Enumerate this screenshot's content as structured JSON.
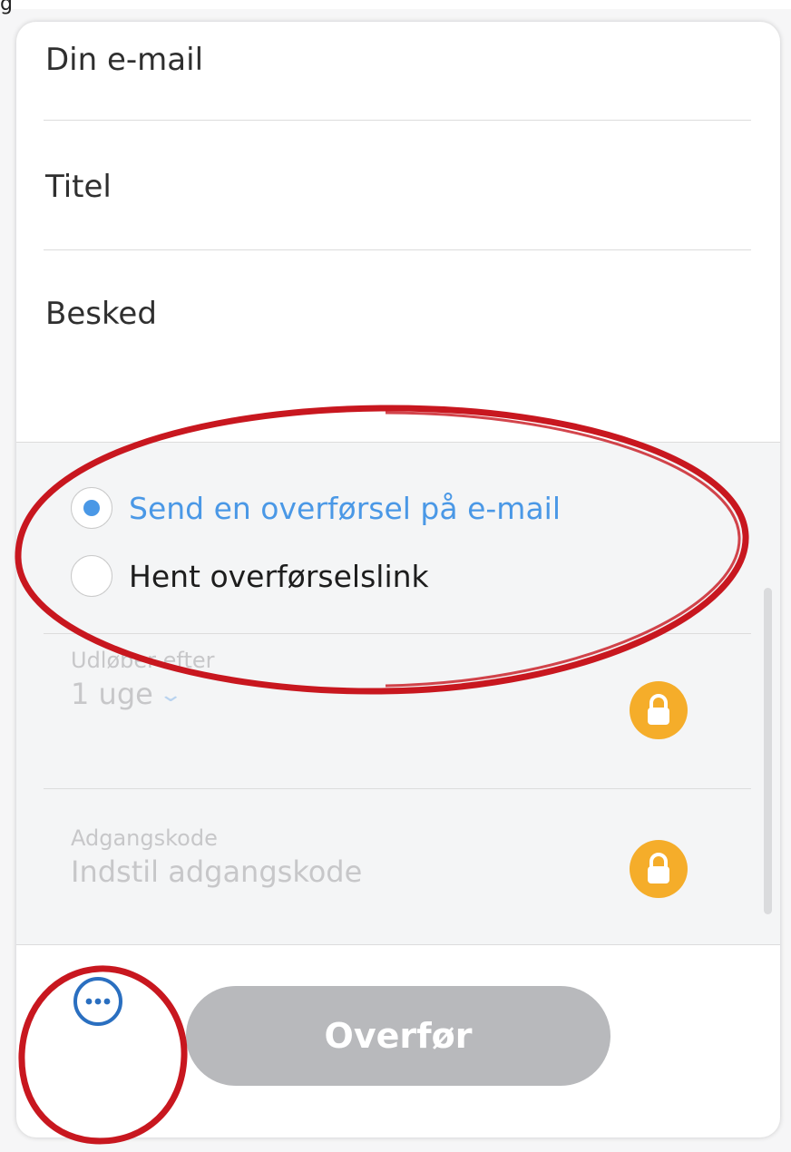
{
  "top_peek_letter": "g",
  "form": {
    "email_placeholder": "Din e-mail",
    "title_placeholder": "Titel",
    "message_placeholder": "Besked"
  },
  "transfer_mode": {
    "options": [
      {
        "label": "Send en overførsel på e-mail",
        "selected": true
      },
      {
        "label": "Hent overførselslink",
        "selected": false
      }
    ]
  },
  "settings": {
    "expires_label": "Udløber efter",
    "expires_value": "1 uge",
    "password_label": "Adgangskode",
    "password_value": "Indstil adgangskode",
    "lock_icon": "lock-icon"
  },
  "actions": {
    "transfer_label": "Overfør",
    "more_icon": "more-options-icon"
  },
  "colors": {
    "accent_blue": "#4a98e6",
    "lock_orange": "#f5ad2a",
    "disabled_button": "#b8b9bc",
    "annotation_red": "#c8171f"
  }
}
